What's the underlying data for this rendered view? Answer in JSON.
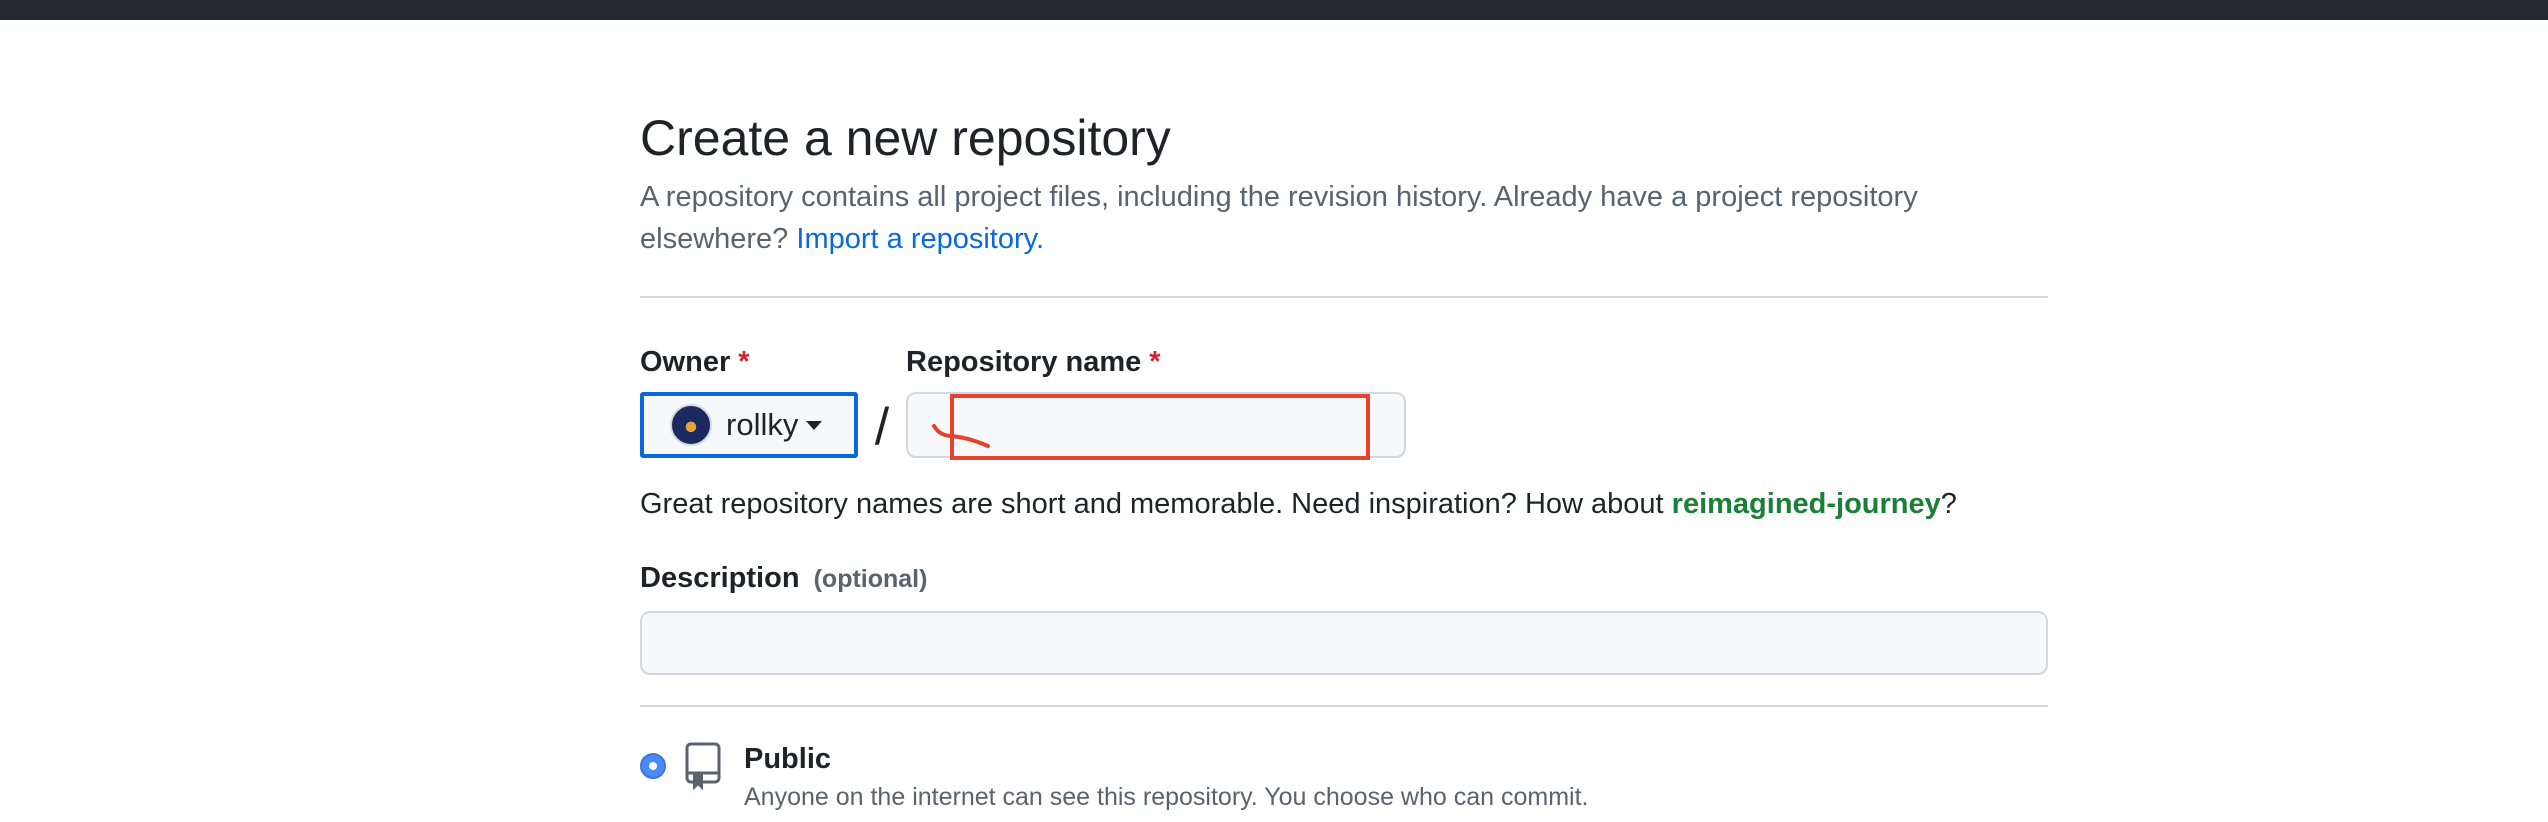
{
  "page": {
    "title": "Create a new repository",
    "subtitle_text": "A repository contains all project files, including the revision history. Already have a project repository elsewhere?",
    "import_link": "Import a repository."
  },
  "owner": {
    "label": "Owner",
    "required_mark": "*",
    "selected": "rollky",
    "avatar_icon": "owner-avatar"
  },
  "separator": "/",
  "repo_name": {
    "label": "Repository name",
    "required_mark": "*",
    "value": "",
    "placeholder": ""
  },
  "hint": {
    "text": "Great repository names are short and memorable. Need inspiration? How about",
    "suggestion": "reimagined-journey",
    "suffix": "?"
  },
  "description": {
    "label": "Description",
    "optional": "(optional)",
    "value": ""
  },
  "visibility": {
    "options": [
      {
        "label": "Public",
        "description": "Anyone on the internet can see this repository. You choose who can commit.",
        "selected": true,
        "icon": "repo-icon"
      }
    ]
  },
  "colors": {
    "accent": "#0969da",
    "required": "#d1242f",
    "suggestion": "#1a7f37",
    "annotation": "#e5432d",
    "topbar": "#24292f"
  }
}
